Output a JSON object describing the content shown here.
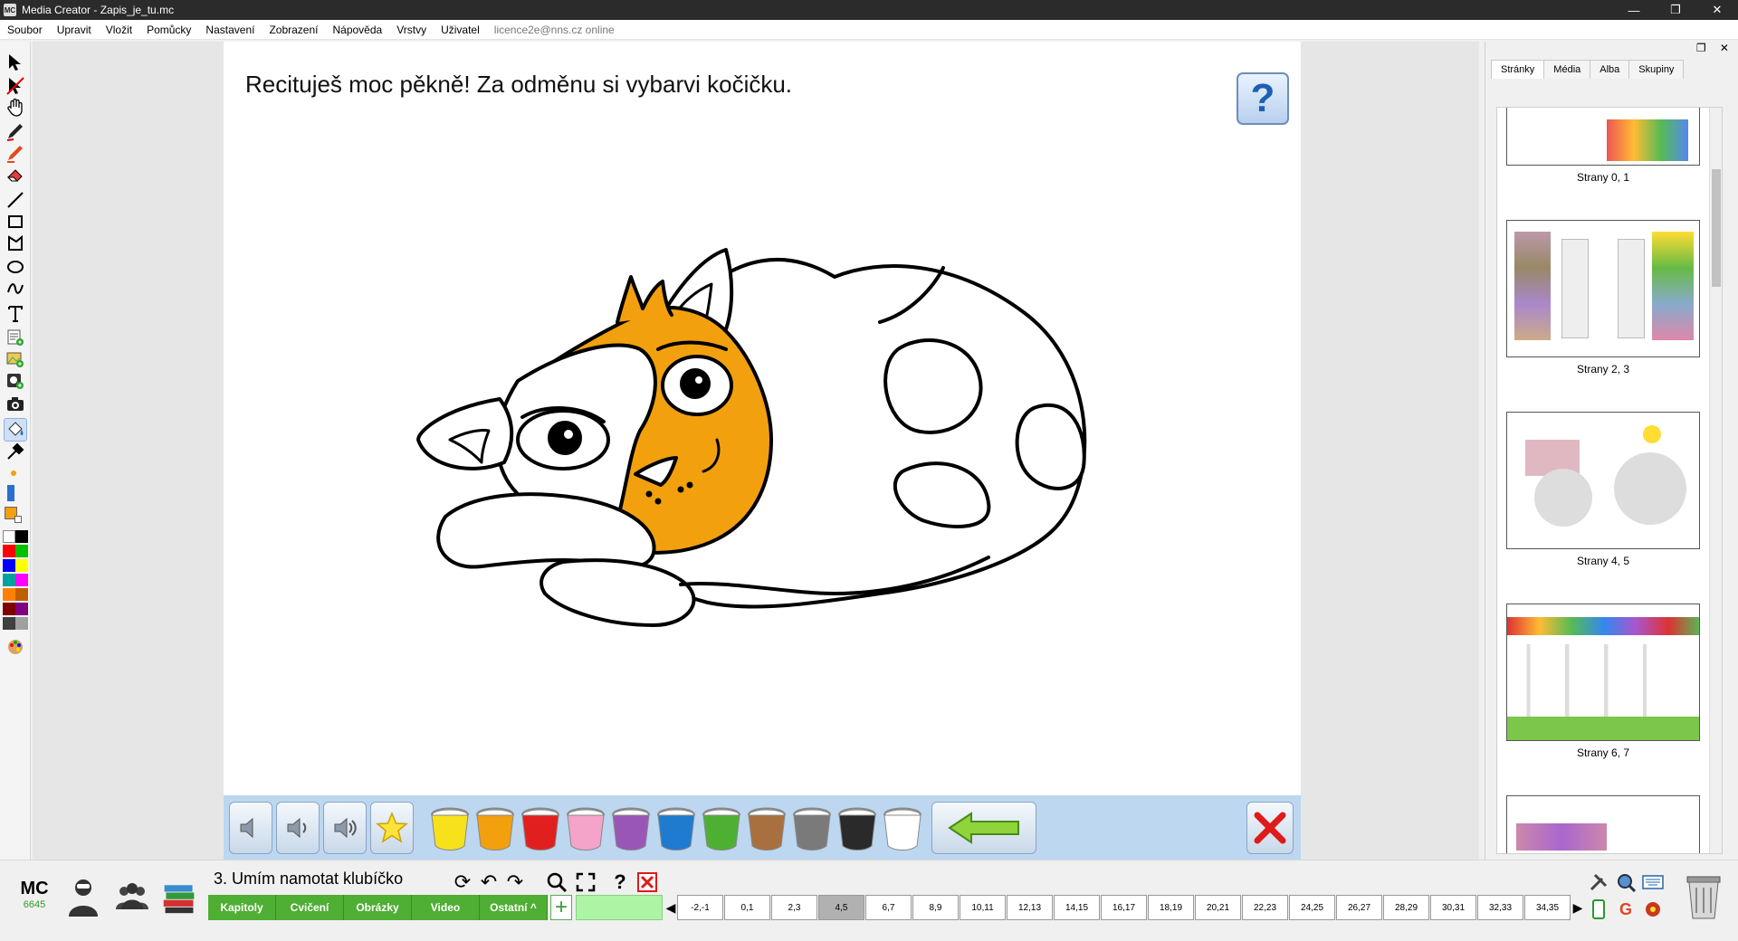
{
  "window": {
    "title": "Media Creator - Zapis_je_tu.mc",
    "app_icon": "MC"
  },
  "menu": {
    "items": [
      "Soubor",
      "Upravit",
      "Vložit",
      "Pomůcky",
      "Nastavení",
      "Zobrazení",
      "Nápověda",
      "Vrstvy",
      "Uživatel"
    ],
    "user_status": "licence2e@nns.cz online"
  },
  "page": {
    "instruction": "Recituješ moc pěkně! Za odměnu si vybarvi kočičku.",
    "help_symbol": "?",
    "accent_orange": "#f2a00e"
  },
  "palette": {
    "speaker_buttons": [
      "speaker-quiet-icon",
      "speaker-medium-icon",
      "speaker-loud-icon"
    ],
    "star_icon": "star-icon",
    "bucket_colors": [
      "#f7e11a",
      "#f2a00e",
      "#e11f1f",
      "#f3a4c8",
      "#9a56b6",
      "#1f7bd0",
      "#4db033",
      "#a8703e",
      "#7a7a7a",
      "#2a2a2a",
      "#ffffff"
    ],
    "back_icon": "back-arrow-icon",
    "close_icon": "close-x-icon"
  },
  "right_panel": {
    "tabs": [
      "Stránky",
      "Média",
      "Alba",
      "Skupiny"
    ],
    "active_tab": "Stránky",
    "pages": [
      "Strany 0, 1",
      "Strany 2, 3",
      "Strany 4, 5",
      "Strany 6, 7"
    ]
  },
  "bottom": {
    "logo": "MC",
    "version": "6645",
    "chapter_title": "3. Umím namotat klubíčko",
    "tabs": [
      "Kapitoly",
      "Cvičení",
      "Obrázky",
      "Video",
      "Ostatní"
    ],
    "ostatni_caret": "^",
    "add_symbol": "+",
    "page_numbers": [
      "-2,-1",
      "0,1",
      "2,3",
      "4,5",
      "6,7",
      "8,9",
      "10,11",
      "12,13",
      "14,15",
      "16,17",
      "18,19",
      "20,21",
      "22,23",
      "24,25",
      "26,27",
      "28,29",
      "30,31",
      "32,33",
      "34,35"
    ],
    "active_page": "4,5",
    "nav_left": "◀",
    "nav_right": "▶",
    "help_symbol": "?"
  },
  "left_colors": [
    "#000000",
    "#ff0000",
    "#00c000",
    "#0000ff",
    "#ffff00",
    "#00a0a0",
    "#ff00ff",
    "#ff8000",
    "#800000",
    "#800080",
    "#404040",
    "#a0a0a0"
  ]
}
